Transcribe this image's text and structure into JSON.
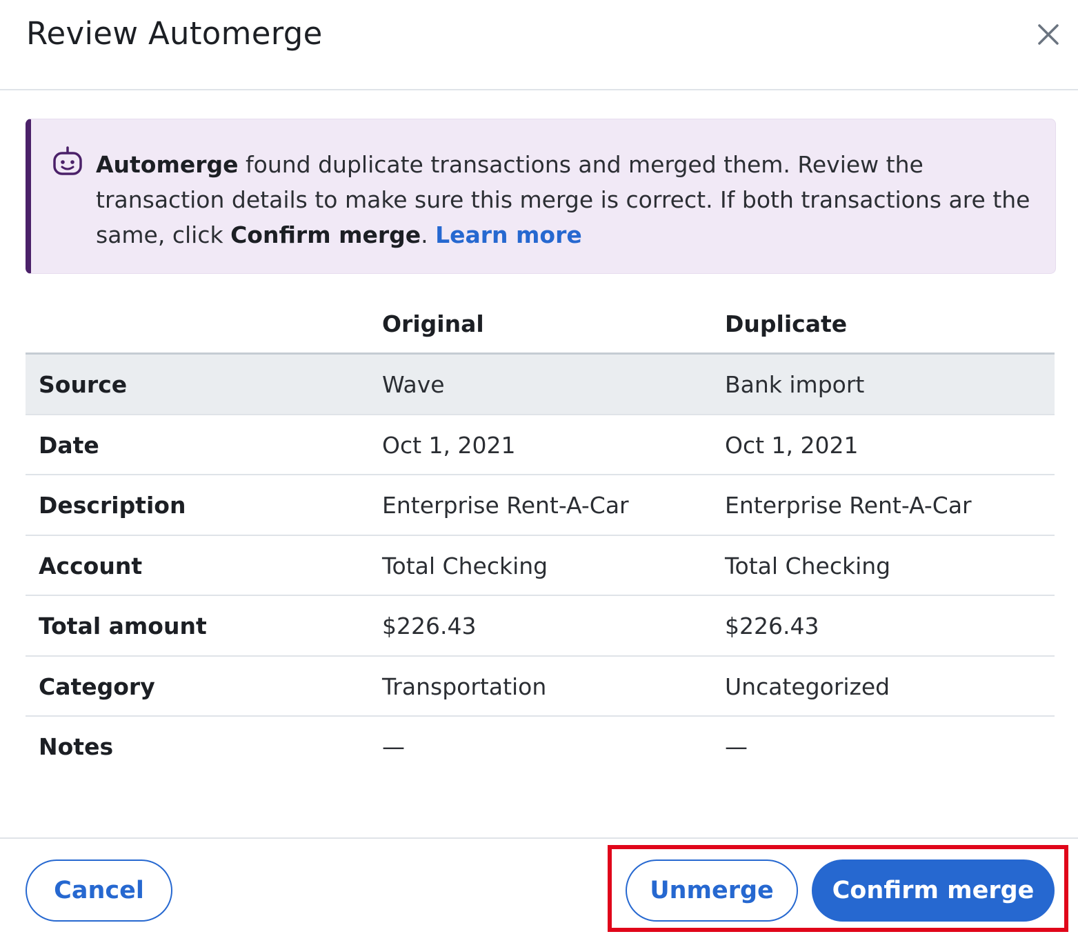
{
  "dialog": {
    "title": "Review Automerge",
    "close_icon": "close-icon"
  },
  "notice": {
    "icon": "robot-icon",
    "bold_lead": "Automerge",
    "text_1": " found duplicate transactions and merged them. Review the transaction details to make sure this merge is correct. If both transactions are the same, click ",
    "bold_action": "Confirm merge",
    "text_2": ". ",
    "link_label": "Learn more",
    "accent_color": "#4b2169",
    "background_color": "#f1e9f6"
  },
  "table": {
    "headers": [
      "",
      "Original",
      "Duplicate"
    ],
    "rows": [
      {
        "label": "Source",
        "original": "Wave",
        "duplicate": "Bank import"
      },
      {
        "label": "Date",
        "original": "Oct 1, 2021",
        "duplicate": "Oct 1, 2021"
      },
      {
        "label": "Description",
        "original": "Enterprise Rent-A-Car",
        "duplicate": "Enterprise Rent-A-Car"
      },
      {
        "label": "Account",
        "original": "Total Checking",
        "duplicate": "Total Checking"
      },
      {
        "label": "Total amount",
        "original": "$226.43",
        "duplicate": "$226.43"
      },
      {
        "label": "Category",
        "original": "Transportation",
        "duplicate": "Uncategorized"
      },
      {
        "label": "Notes",
        "original": "—",
        "duplicate": "—"
      }
    ]
  },
  "footer": {
    "cancel_label": "Cancel",
    "unmerge_label": "Unmerge",
    "confirm_label": "Confirm merge",
    "primary_color": "#2668d0",
    "highlight_color": "#e0061a"
  }
}
